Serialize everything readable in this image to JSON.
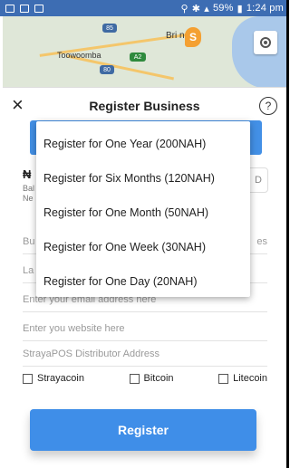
{
  "status_bar": {
    "battery": "59%",
    "time": "1:24 pm"
  },
  "map": {
    "labels": {
      "toowoomba": "Toowoomba",
      "brisbane": "Bri    ne"
    },
    "shields": {
      "a": "85",
      "b": "A2",
      "c": "80"
    },
    "pin_label": "S"
  },
  "header": {
    "title": "Register Business",
    "close_label": "×",
    "help_label": "?"
  },
  "balance": {
    "currency": "₦",
    "label": "Bal",
    "sub": "Ne",
    "button_label": "D"
  },
  "fields": {
    "business_name_prefix": "Bu",
    "business_name_tail": "es",
    "location_prefix": "La",
    "email_placeholder": "Enter your email address here",
    "website_placeholder": "Enter you website here",
    "distributor_placeholder": "StrayaPOS Distributor Address"
  },
  "coins": [
    "Strayacoin",
    "Bitcoin",
    "Litecoin"
  ],
  "register_label": "Register",
  "plan_options": [
    "Register for One Year (200NAH)",
    "Register for Six Months (120NAH)",
    "Register for One Month (50NAH)",
    "Register for One Week (30NAH)",
    "Register for One Day (20NAH)"
  ],
  "colors": {
    "primary": "#3f8ee8",
    "status_bar": "#3d6db3"
  }
}
